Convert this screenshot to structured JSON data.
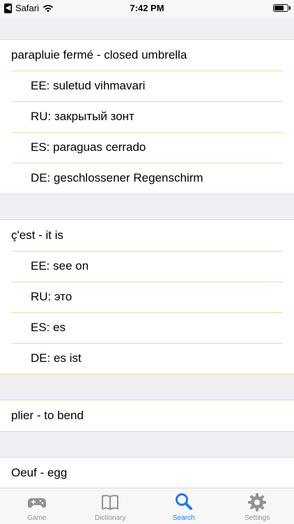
{
  "status_bar": {
    "back_glyph": "◀",
    "carrier": "Safari",
    "time": "7:42 PM"
  },
  "sections": [
    {
      "head": "parapluie fermé - closed umbrella",
      "translations": [
        "EE: suletud vihmavari",
        "RU: закрытый зонт",
        "ES: paraguas cerrado",
        "DE: geschlossener Regenschirm"
      ]
    },
    {
      "head": "ç'est - it is",
      "translations": [
        "EE: see on",
        "RU: это",
        "ES: es",
        "DE: es ist"
      ]
    },
    {
      "head": "plier - to bend",
      "translations": []
    },
    {
      "head": "Oeuf - egg",
      "translations": []
    }
  ],
  "tab_bar": {
    "tabs": [
      {
        "label": "Game",
        "icon": "gamepad-icon",
        "active": false
      },
      {
        "label": "Dictionary",
        "icon": "book-icon",
        "active": false
      },
      {
        "label": "Search",
        "icon": "magnifier-icon",
        "active": true
      },
      {
        "label": "Settings",
        "icon": "gear-icon",
        "active": false
      }
    ]
  },
  "colors": {
    "accent": "#1a7cf5",
    "separator": "#f3d6a6",
    "background": "#efeff4",
    "inactive_tab": "#929292"
  }
}
